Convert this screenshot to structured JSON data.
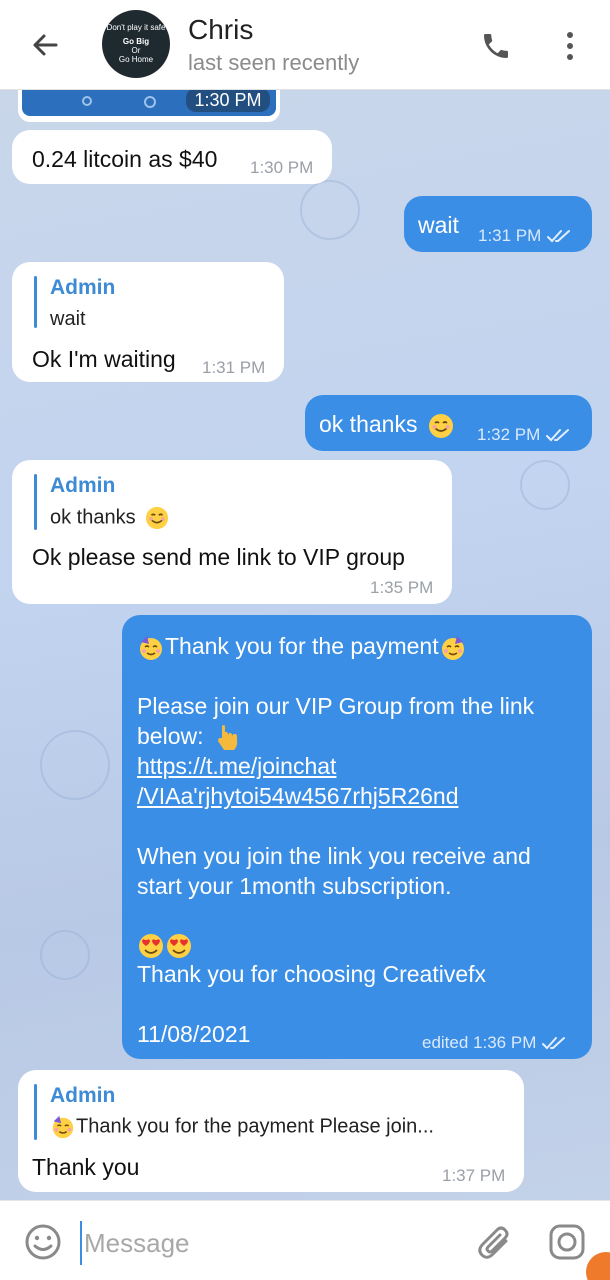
{
  "header": {
    "contact_name": "Chris",
    "status": "last seen recently",
    "avatar_lines": [
      "Don't play it safe",
      "Go Big",
      "Or",
      "Go Home"
    ]
  },
  "messages": [
    {
      "direction": "in",
      "partial_time": "1:30 PM"
    },
    {
      "direction": "in",
      "text": "0.24 litcoin as $40",
      "time": "1:30 PM"
    },
    {
      "direction": "out",
      "text": "wait",
      "time": "1:31 PM",
      "status": "read"
    },
    {
      "direction": "in",
      "reply_to": {
        "name": "Admin",
        "text": "wait"
      },
      "text": "Ok I'm waiting",
      "time": "1:31 PM"
    },
    {
      "direction": "out",
      "text": "ok thanks",
      "time": "1:32 PM",
      "status": "read"
    },
    {
      "direction": "in",
      "reply_to": {
        "name": "Admin",
        "text": "ok thanks"
      },
      "text": "Ok please send me link to VIP group",
      "time": "1:35 PM"
    },
    {
      "direction": "out",
      "lines": {
        "l1": "Thank you for the payment",
        "l2": "Please join our VIP Group from the link",
        "l3": "below:",
        "l4": "https://t.me/joinchat",
        "l5": "/VIAa'rjhytoi54w4567rhj5R26nd",
        "l6": "When you join the link you receive and",
        "l7": "start your 1month  subscription.",
        "l8": "Thank you for choosing Creativefx",
        "l9": "11/08/2021"
      },
      "time": "edited 1:36 PM",
      "status": "read"
    },
    {
      "direction": "in",
      "reply_to": {
        "name": "Admin",
        "text": "Thank you for the payment  Please join..."
      },
      "text": "Thank you",
      "time": "1:37 PM"
    }
  ],
  "input": {
    "placeholder": "Message"
  },
  "icons": {
    "back": "arrow-left-icon",
    "call": "phone-icon",
    "menu": "more-vertical-icon",
    "emoji": "smile-icon",
    "attach": "paperclip-icon",
    "camera": "camera-icon",
    "read": "double-check-icon"
  },
  "colors": {
    "outgoing_bubble": "#3a8ee6",
    "incoming_bubble": "#ffffff",
    "reply_accent": "#3d8ad5",
    "chat_background": "#c2d4ef"
  }
}
